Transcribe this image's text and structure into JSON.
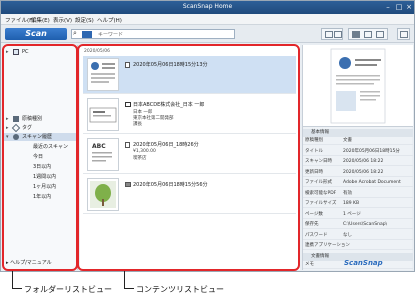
{
  "window": {
    "title": "ScanSnap Home",
    "menus": [
      "ファイル(F)",
      "編集(E)",
      "表示(V)",
      "設定(S)",
      "ヘルプ(H)"
    ]
  },
  "toolbar": {
    "scan_label": "Scan",
    "search_placeholder": "キーワード"
  },
  "folder_list": {
    "pc_label": "PC",
    "items": [
      {
        "label": "原稿種別"
      },
      {
        "label": "タグ"
      },
      {
        "label": "スキャン履歴"
      }
    ],
    "sub_items": [
      "最近のスキャン",
      "今日",
      "3日以内",
      "1週間以内",
      "1ヶ月以内",
      "1年以内"
    ],
    "help_label": "ヘルプ/マニュアル"
  },
  "content_list": {
    "date_header": "2020/05/06",
    "rows": [
      {
        "title": "2020年05月06日18時15分13分",
        "lines": []
      },
      {
        "title": "日本ABCDE株式会社_日本 一郎",
        "lines": [
          "日本 一郎",
          "東京本社第二開発部",
          "課長"
        ]
      },
      {
        "title": "2020年05月06日_18時26分",
        "lines": [
          "¥1,300.00",
          "喫茶店"
        ]
      },
      {
        "title": "2020年05月06日18時15分56分",
        "lines": []
      }
    ]
  },
  "info_pane": {
    "section_basic": "基本情報",
    "section_text": "文書情報",
    "fields": [
      {
        "k": "原稿種別",
        "v": "文書"
      },
      {
        "k": "タイトル",
        "v": "2020年05月06日18時15分"
      },
      {
        "k": "スキャン日時",
        "v": "2020/05/06 18:22"
      },
      {
        "k": "更新日時",
        "v": "2020/05/06 18:22"
      },
      {
        "k": "ファイル形式",
        "v": "Adobe Acrobat Document"
      },
      {
        "k": "検索可能なPDF",
        "v": "有効"
      },
      {
        "k": "ファイルサイズ",
        "v": "189 KB"
      },
      {
        "k": "ページ数",
        "v": "1 ページ"
      },
      {
        "k": "保存先",
        "v": "C:\\Users\\ScanSnap\\"
      },
      {
        "k": "パスワード",
        "v": "なし"
      },
      {
        "k": "連携アプリケーション",
        "v": ""
      }
    ],
    "memo_label": "メモ",
    "brand": "ScanSnap"
  },
  "callouts": {
    "folder_list": "フォルダーリストビュー",
    "content_list": "コンテンツリストビュー"
  },
  "colors": {
    "highlight": "#e2262a",
    "accent": "#2a6bbd"
  }
}
